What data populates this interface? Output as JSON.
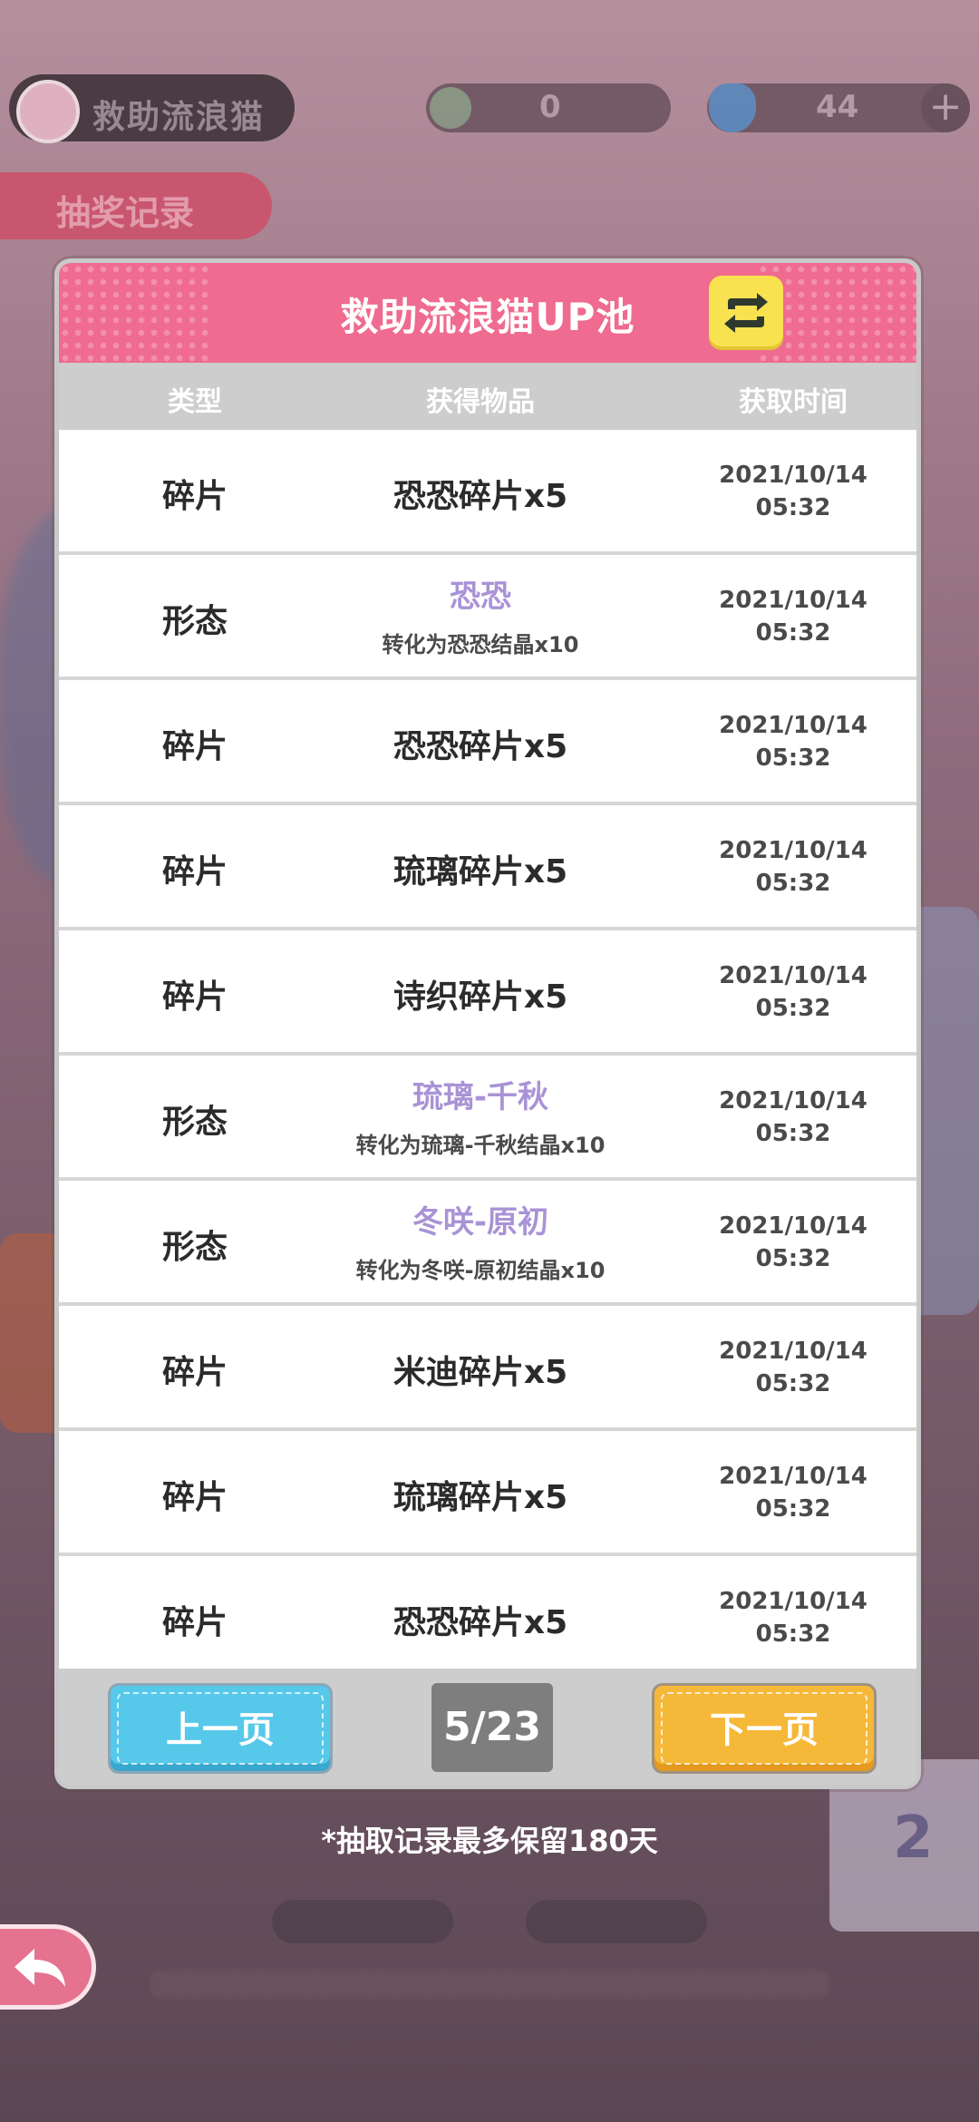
{
  "background": {
    "top_left_label": "救助流浪猫",
    "record_tab_label": "抽奖记录",
    "currency_1": "0",
    "currency_2": "44",
    "side_card_number": "2"
  },
  "modal": {
    "title": "救助流浪猫UP池",
    "columns": [
      "类型",
      "获得物品",
      "获取时间"
    ],
    "rows": [
      {
        "type": "碎片",
        "item": "恐恐碎片x5",
        "sub": "",
        "time_date": "2021/10/14",
        "time_clock": "05:32"
      },
      {
        "type": "形态",
        "item": "恐恐",
        "sub": "转化为恐恐结晶x10",
        "time_date": "2021/10/14",
        "time_clock": "05:32"
      },
      {
        "type": "碎片",
        "item": "恐恐碎片x5",
        "sub": "",
        "time_date": "2021/10/14",
        "time_clock": "05:32"
      },
      {
        "type": "碎片",
        "item": "琉璃碎片x5",
        "sub": "",
        "time_date": "2021/10/14",
        "time_clock": "05:32"
      },
      {
        "type": "碎片",
        "item": "诗织碎片x5",
        "sub": "",
        "time_date": "2021/10/14",
        "time_clock": "05:32"
      },
      {
        "type": "形态",
        "item": "琉璃-千秋",
        "sub": "转化为琉璃-千秋结晶x10",
        "time_date": "2021/10/14",
        "time_clock": "05:32"
      },
      {
        "type": "形态",
        "item": "冬咲-原初",
        "sub": "转化为冬咲-原初结晶x10",
        "time_date": "2021/10/14",
        "time_clock": "05:32"
      },
      {
        "type": "碎片",
        "item": "米迪碎片x5",
        "sub": "",
        "time_date": "2021/10/14",
        "time_clock": "05:32"
      },
      {
        "type": "碎片",
        "item": "琉璃碎片x5",
        "sub": "",
        "time_date": "2021/10/14",
        "time_clock": "05:32"
      },
      {
        "type": "碎片",
        "item": "恐恐碎片x5",
        "sub": "",
        "time_date": "2021/10/14",
        "time_clock": "05:32"
      }
    ],
    "prev_label": "上一页",
    "next_label": "下一页",
    "page_indicator": "5/23"
  },
  "note": "*抽取记录最多保留180天",
  "icons": {
    "swap": "swap-arrows-icon",
    "back": "back-arrow-icon"
  },
  "colors": {
    "header_pink": "#ef6b8f",
    "form_name_purple": "#a993d6",
    "prev_blue": "#56c8ea",
    "next_orange": "#f6b838",
    "swap_yellow": "#f9e24f"
  }
}
